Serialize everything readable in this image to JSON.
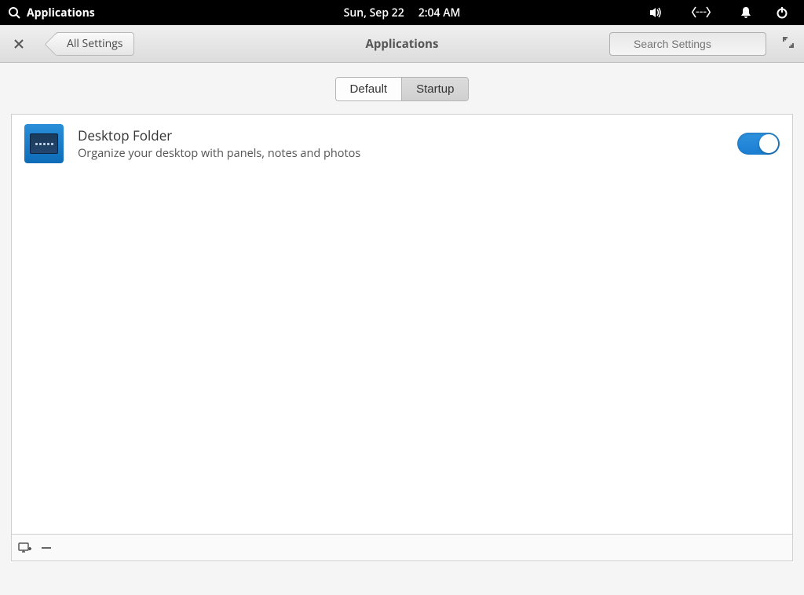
{
  "system_bar": {
    "app_label": "Applications",
    "date": "Sun, Sep 22",
    "time": "2:04 AM"
  },
  "header": {
    "back_label": "All Settings",
    "title": "Applications",
    "search_placeholder": "Search Settings"
  },
  "tabs": {
    "default": "Default",
    "startup": "Startup",
    "active": "startup"
  },
  "apps": [
    {
      "name": "Desktop Folder",
      "description": "Organize your desktop with panels, notes and photos",
      "enabled": true,
      "icon": "desktop-panel-icon"
    }
  ]
}
